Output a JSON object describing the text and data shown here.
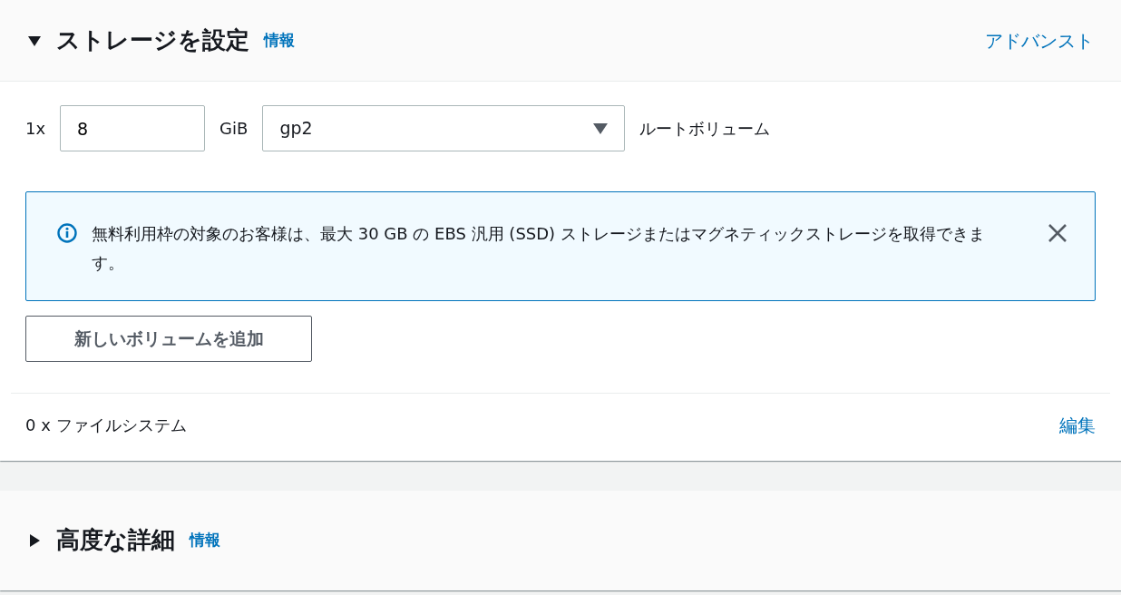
{
  "storage": {
    "expanded": true,
    "title": "ストレージを設定",
    "info": "情報",
    "advanced": "アドバンスト",
    "volume": {
      "count": "1x",
      "size": "8",
      "unit": "GiB",
      "type": "gp2",
      "label": "ルートボリューム"
    },
    "alert": {
      "text": "無料利用枠の対象のお客様は、最大 30 GB の EBS 汎用 (SSD) ストレージまたはマグネティックストレージを取得できます。"
    },
    "add_button": "新しいボリュームを追加",
    "filesystems": {
      "text": "0 x ファイルシステム",
      "edit": "編集"
    }
  },
  "advanced_details": {
    "expanded": false,
    "title": "高度な詳細",
    "info": "情報"
  }
}
